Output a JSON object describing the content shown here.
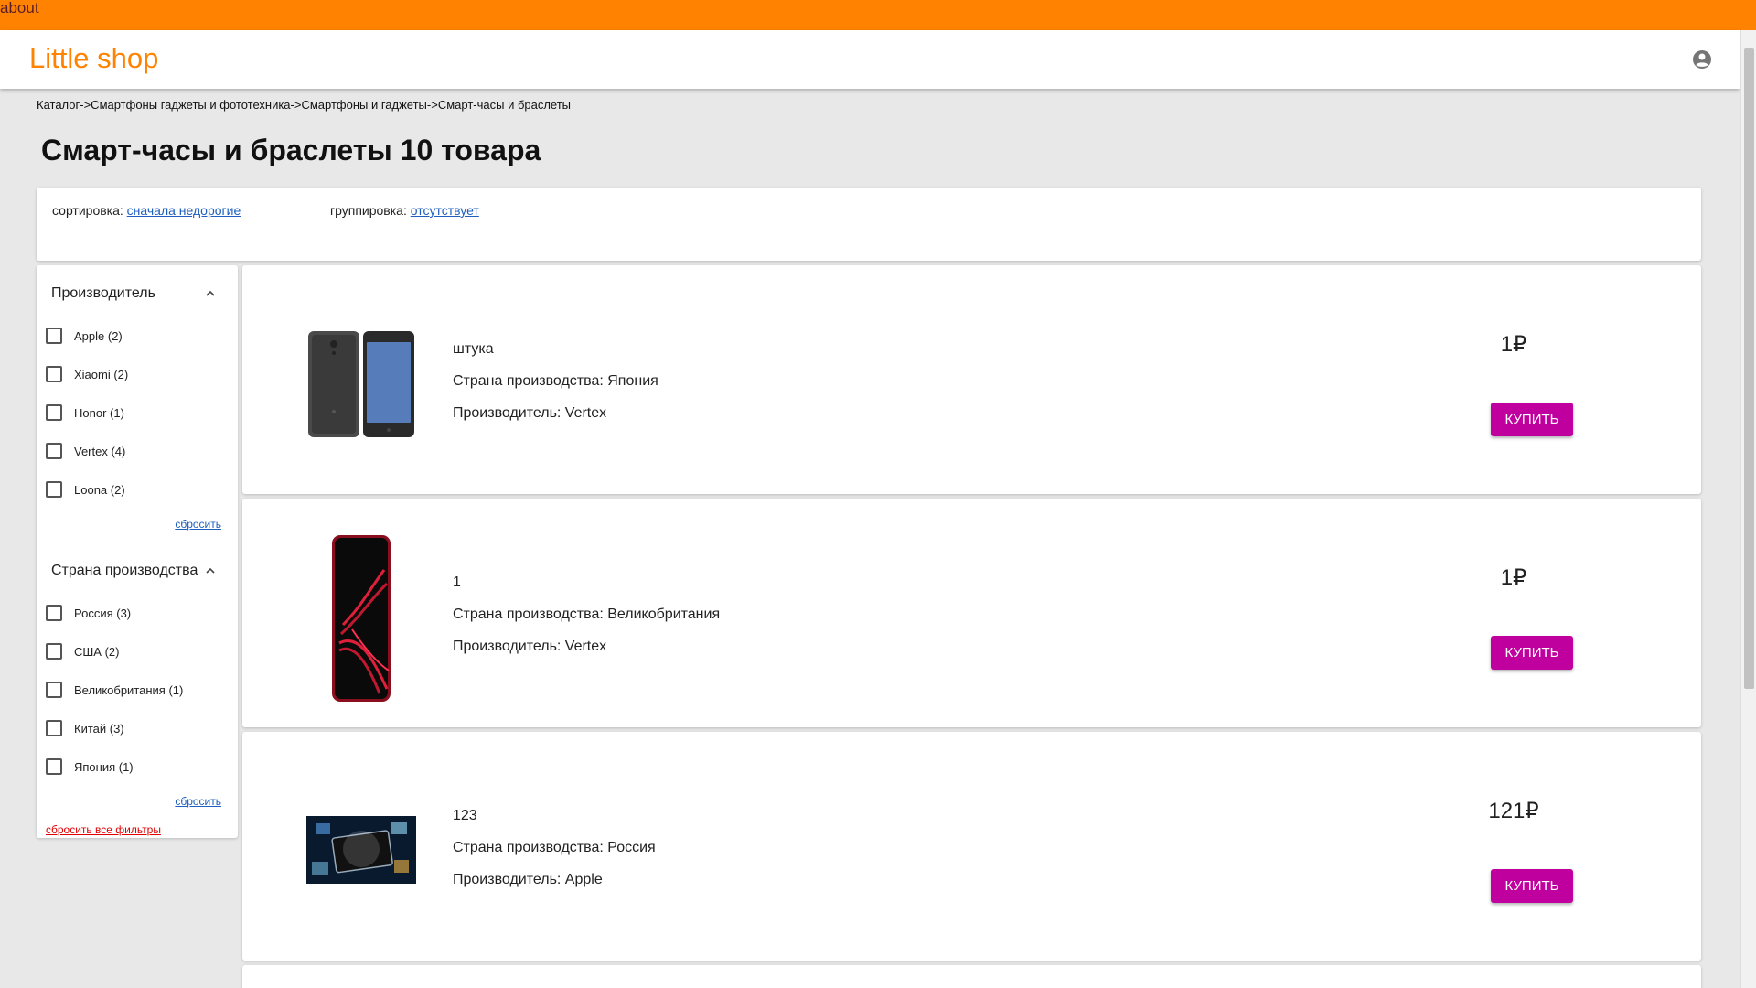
{
  "topbar": {
    "about": "about"
  },
  "appbar": {
    "brand": "Little shop",
    "account_icon": "account-circle-icon"
  },
  "breadcrumb": "Каталог->Смартфоны гаджеты и фототехника->Смартфоны и гаджеты->Смарт-часы и браслеты",
  "page_title": "Смарт-часы и браслеты 10 товара",
  "sort": {
    "sort_label": "сортировка: ",
    "sort_value": "сначала недорогие",
    "group_label": "группировка: ",
    "group_value": "отсутствует"
  },
  "filters": {
    "manufacturer": {
      "title": "Производитель",
      "options": [
        "Apple (2)",
        "Xiaomi (2)",
        "Honor (1)",
        "Vertex (4)",
        "Loona (2)"
      ],
      "reset": "сбросить"
    },
    "country": {
      "title": "Страна производства",
      "options": [
        "Россия (3)",
        "США (2)",
        "Великобритания (1)",
        "Китай (3)",
        "Япония (1)"
      ],
      "reset": "сбросить"
    },
    "reset_all": "сбросить все фильтры"
  },
  "products": [
    {
      "name": "штука",
      "country": "Страна производства: Япония",
      "maker": "Производитель: Vertex",
      "price": "1₽",
      "buy": "КУПИТЬ"
    },
    {
      "name": "1",
      "country": "Страна производства: Великобритания",
      "maker": "Производитель: Vertex",
      "price": "1₽",
      "buy": "КУПИТЬ"
    },
    {
      "name": "123",
      "country": "Страна производства: Россия",
      "maker": "Производитель: Apple",
      "price": "121₽",
      "buy": "КУПИТЬ"
    }
  ],
  "colors": {
    "accent": "#ff8200",
    "buy_button": "#c0009e",
    "link": "#1e5fbf",
    "reset_all": "#e00000"
  }
}
